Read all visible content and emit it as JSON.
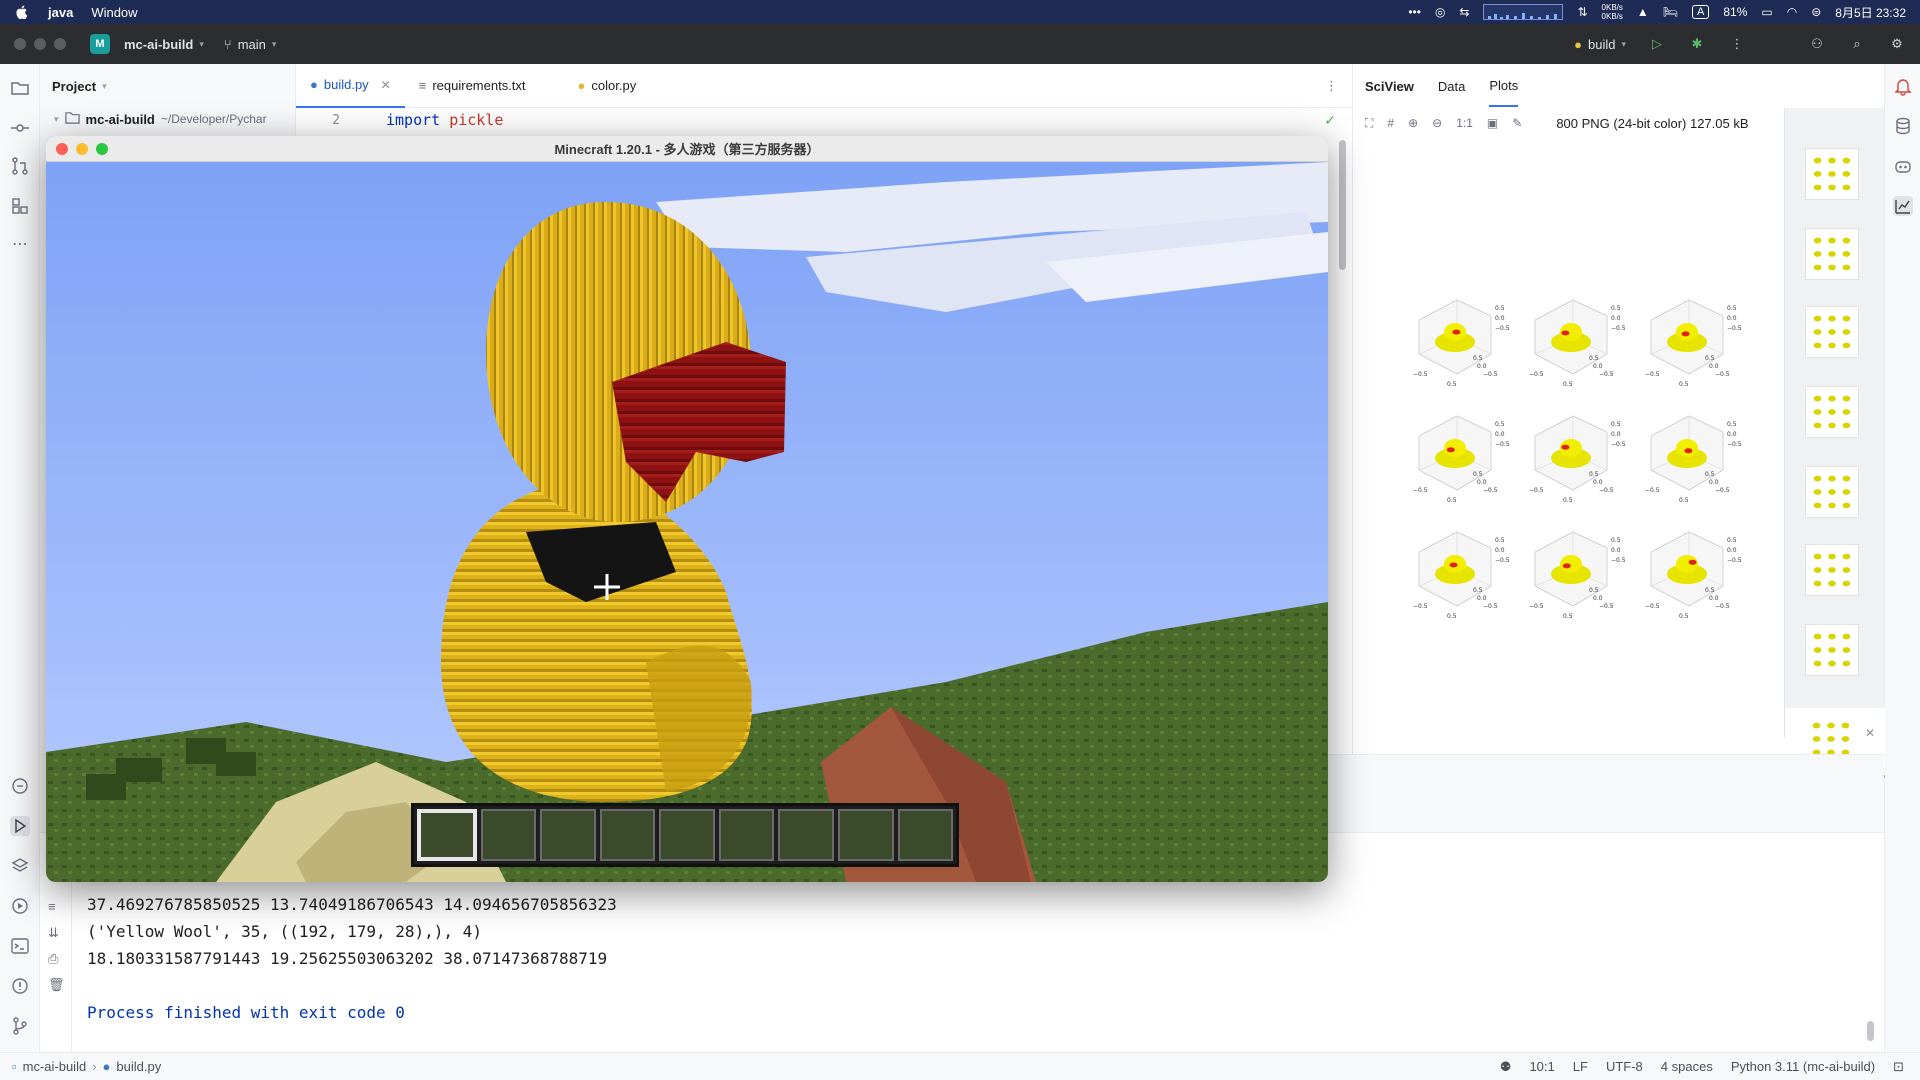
{
  "menubar": {
    "app": "java",
    "items": [
      "Window"
    ],
    "net_up": "0KB/s",
    "net_down": "0KB/s",
    "ime": "A",
    "battery": "81%",
    "datetime": "8月5日  23:32"
  },
  "toolbar": {
    "project_badge": "M",
    "project_name": "mc-ai-build",
    "branch": "main",
    "run_config": "build"
  },
  "project_panel": {
    "title": "Project",
    "root_name": "mc-ai-build",
    "root_path": "~/Developer/Pychar"
  },
  "editor": {
    "tabs": [
      {
        "label": "build.py",
        "active": true
      },
      {
        "label": "requirements.txt",
        "active": false
      },
      {
        "label": "color.py",
        "active": false
      }
    ],
    "line_number": "2",
    "code_keyword": "import",
    "code_module": "pickle"
  },
  "sciview": {
    "title": "SciView",
    "tabs": [
      "Data",
      "Plots"
    ],
    "zoom_label": "1:1",
    "image_info": "800 PNG (24-bit color) 127.05 kB",
    "axis_ticks": {
      "z": [
        "0.5",
        "0.0",
        "−0.5"
      ],
      "x": [
        "−0.5",
        "0.5"
      ],
      "y": [
        "0.5",
        "0.0",
        "−0.5"
      ]
    }
  },
  "minecraft": {
    "title": "Minecraft 1.20.1 - 多人游戏（第三方服务器）",
    "hotbar_slots": 9
  },
  "console": {
    "lines": [
      "37.469276785850525 13.74049186706543 14.094656705856323",
      "('Yellow Wool', 35, ((192, 179, 28),), 4)",
      "18.180331587791443 19.25625503063202 38.07147368788719"
    ],
    "exit_message": "Process finished with exit code 0"
  },
  "statusbar": {
    "project": "mc-ai-build",
    "file": "build.py",
    "position": "10:1",
    "line_sep": "LF",
    "encoding": "UTF-8",
    "indent": "4 spaces",
    "interpreter": "Python 3.11 (mc-ai-build)"
  },
  "colors": {
    "duck_yellow": "#e0b81c",
    "beak_red": "#8e1414",
    "accent": "#3574f0",
    "menubar": "#1d2b55"
  }
}
